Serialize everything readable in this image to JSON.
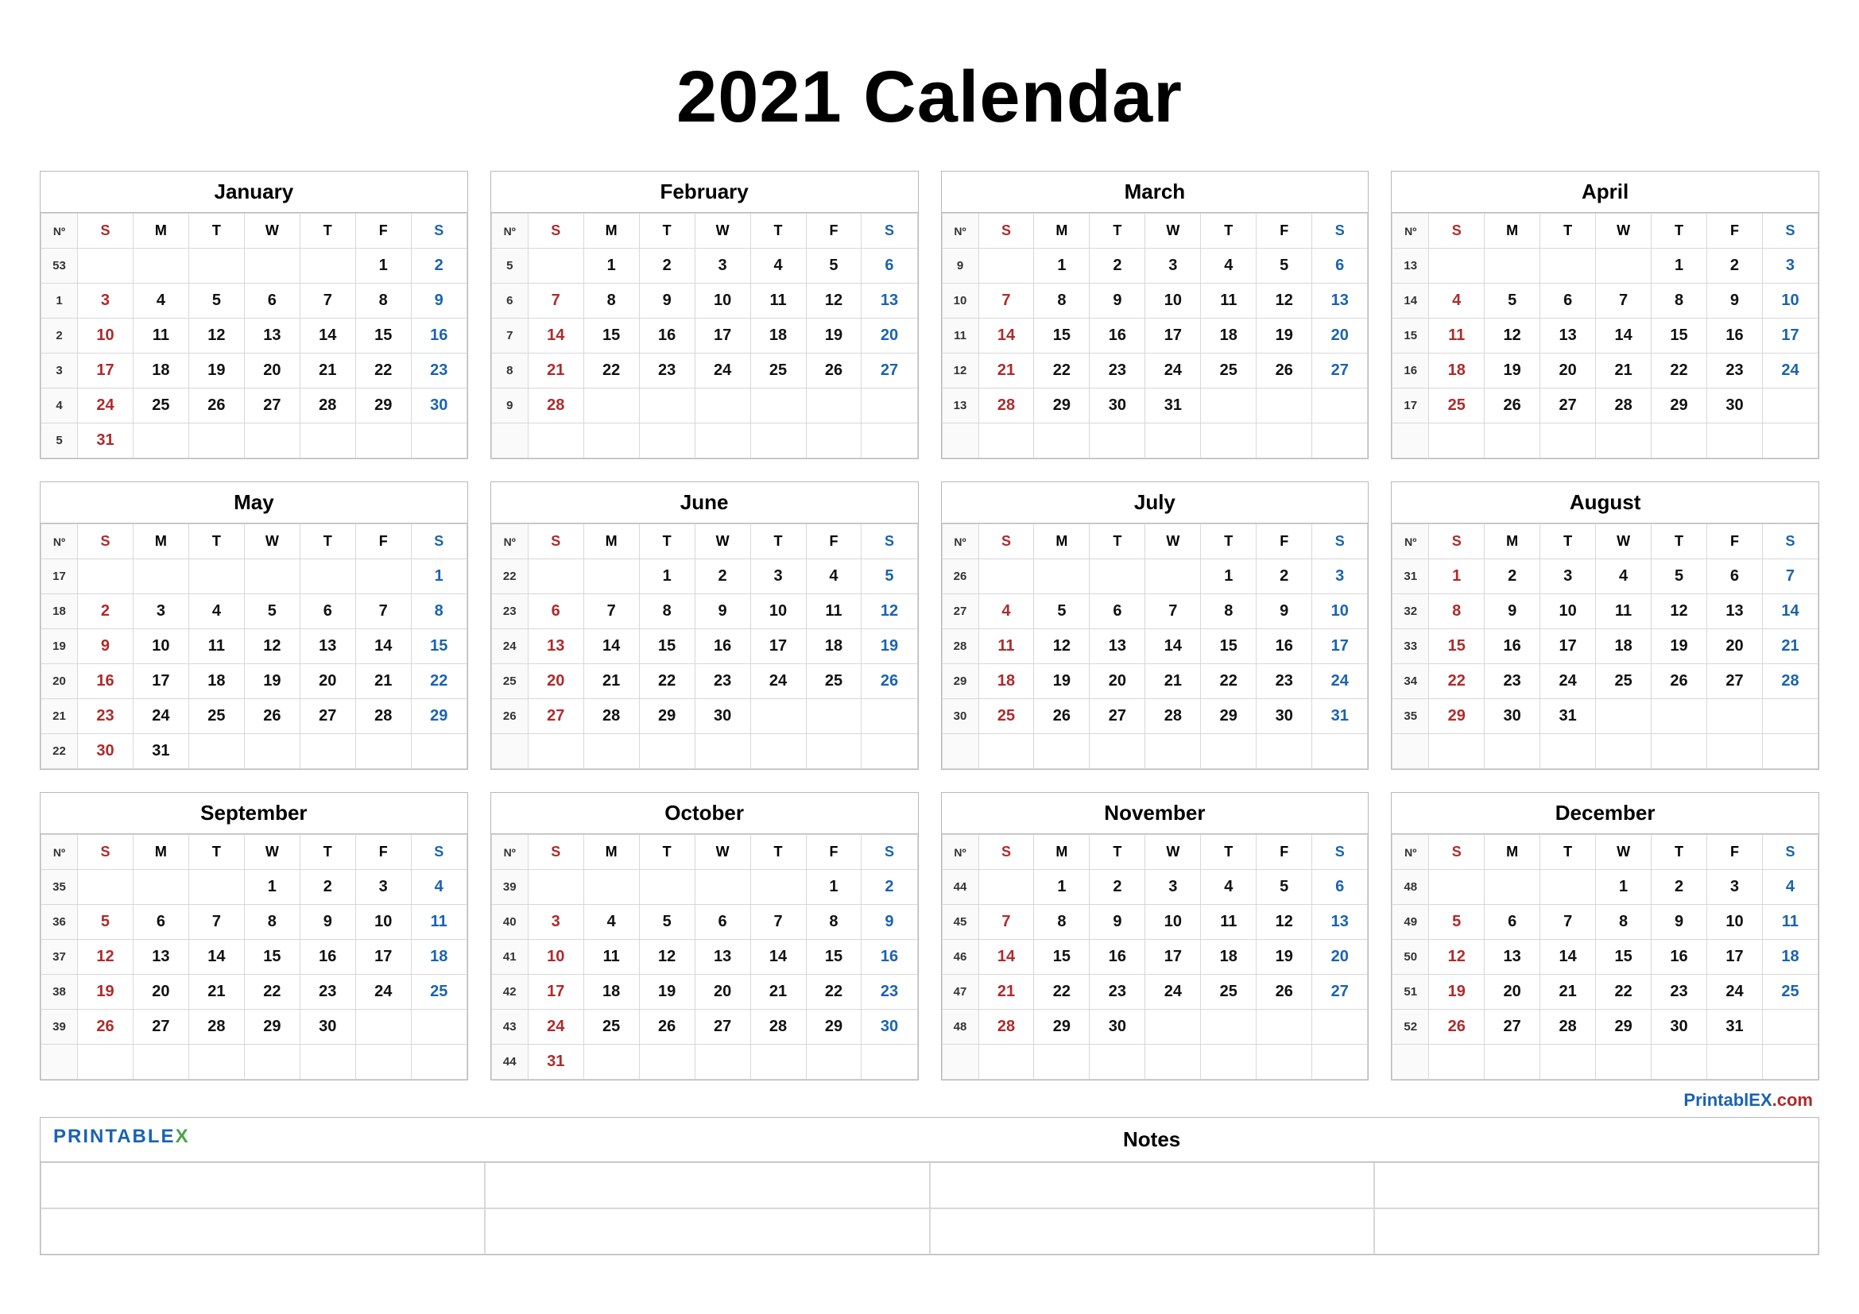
{
  "title": "2021 Calendar",
  "week_header": {
    "nk": "Nº",
    "days": [
      "S",
      "M",
      "T",
      "W",
      "T",
      "F",
      "S"
    ]
  },
  "footer": {
    "brand": "PrintablEX",
    "domain": ".com",
    "notes_label": "Notes",
    "logo_text": "PRINTABLE",
    "logo_x": "X"
  },
  "months": [
    {
      "name": "January",
      "weeks": [
        {
          "n": "53",
          "d": [
            "",
            "",
            "",
            "",
            "",
            "1",
            "2"
          ]
        },
        {
          "n": "1",
          "d": [
            "3",
            "4",
            "5",
            "6",
            "7",
            "8",
            "9"
          ]
        },
        {
          "n": "2",
          "d": [
            "10",
            "11",
            "12",
            "13",
            "14",
            "15",
            "16"
          ]
        },
        {
          "n": "3",
          "d": [
            "17",
            "18",
            "19",
            "20",
            "21",
            "22",
            "23"
          ]
        },
        {
          "n": "4",
          "d": [
            "24",
            "25",
            "26",
            "27",
            "28",
            "29",
            "30"
          ]
        },
        {
          "n": "5",
          "d": [
            "31",
            "",
            "",
            "",
            "",
            "",
            ""
          ]
        }
      ]
    },
    {
      "name": "February",
      "weeks": [
        {
          "n": "5",
          "d": [
            "",
            "1",
            "2",
            "3",
            "4",
            "5",
            "6"
          ]
        },
        {
          "n": "6",
          "d": [
            "7",
            "8",
            "9",
            "10",
            "11",
            "12",
            "13"
          ]
        },
        {
          "n": "7",
          "d": [
            "14",
            "15",
            "16",
            "17",
            "18",
            "19",
            "20"
          ]
        },
        {
          "n": "8",
          "d": [
            "21",
            "22",
            "23",
            "24",
            "25",
            "26",
            "27"
          ]
        },
        {
          "n": "9",
          "d": [
            "28",
            "",
            "",
            "",
            "",
            "",
            ""
          ]
        },
        {
          "n": "",
          "d": [
            "",
            "",
            "",
            "",
            "",
            "",
            ""
          ]
        }
      ]
    },
    {
      "name": "March",
      "weeks": [
        {
          "n": "9",
          "d": [
            "",
            "1",
            "2",
            "3",
            "4",
            "5",
            "6"
          ]
        },
        {
          "n": "10",
          "d": [
            "7",
            "8",
            "9",
            "10",
            "11",
            "12",
            "13"
          ]
        },
        {
          "n": "11",
          "d": [
            "14",
            "15",
            "16",
            "17",
            "18",
            "19",
            "20"
          ]
        },
        {
          "n": "12",
          "d": [
            "21",
            "22",
            "23",
            "24",
            "25",
            "26",
            "27"
          ]
        },
        {
          "n": "13",
          "d": [
            "28",
            "29",
            "30",
            "31",
            "",
            "",
            ""
          ]
        },
        {
          "n": "",
          "d": [
            "",
            "",
            "",
            "",
            "",
            "",
            ""
          ]
        }
      ]
    },
    {
      "name": "April",
      "weeks": [
        {
          "n": "13",
          "d": [
            "",
            "",
            "",
            "",
            "1",
            "2",
            "3"
          ]
        },
        {
          "n": "14",
          "d": [
            "4",
            "5",
            "6",
            "7",
            "8",
            "9",
            "10"
          ]
        },
        {
          "n": "15",
          "d": [
            "11",
            "12",
            "13",
            "14",
            "15",
            "16",
            "17"
          ]
        },
        {
          "n": "16",
          "d": [
            "18",
            "19",
            "20",
            "21",
            "22",
            "23",
            "24"
          ]
        },
        {
          "n": "17",
          "d": [
            "25",
            "26",
            "27",
            "28",
            "29",
            "30",
            ""
          ]
        },
        {
          "n": "",
          "d": [
            "",
            "",
            "",
            "",
            "",
            "",
            ""
          ]
        }
      ]
    },
    {
      "name": "May",
      "weeks": [
        {
          "n": "17",
          "d": [
            "",
            "",
            "",
            "",
            "",
            "",
            "1"
          ]
        },
        {
          "n": "18",
          "d": [
            "2",
            "3",
            "4",
            "5",
            "6",
            "7",
            "8"
          ]
        },
        {
          "n": "19",
          "d": [
            "9",
            "10",
            "11",
            "12",
            "13",
            "14",
            "15"
          ]
        },
        {
          "n": "20",
          "d": [
            "16",
            "17",
            "18",
            "19",
            "20",
            "21",
            "22"
          ]
        },
        {
          "n": "21",
          "d": [
            "23",
            "24",
            "25",
            "26",
            "27",
            "28",
            "29"
          ]
        },
        {
          "n": "22",
          "d": [
            "30",
            "31",
            "",
            "",
            "",
            "",
            ""
          ]
        }
      ]
    },
    {
      "name": "June",
      "weeks": [
        {
          "n": "22",
          "d": [
            "",
            "",
            "1",
            "2",
            "3",
            "4",
            "5"
          ]
        },
        {
          "n": "23",
          "d": [
            "6",
            "7",
            "8",
            "9",
            "10",
            "11",
            "12"
          ]
        },
        {
          "n": "24",
          "d": [
            "13",
            "14",
            "15",
            "16",
            "17",
            "18",
            "19"
          ]
        },
        {
          "n": "25",
          "d": [
            "20",
            "21",
            "22",
            "23",
            "24",
            "25",
            "26"
          ]
        },
        {
          "n": "26",
          "d": [
            "27",
            "28",
            "29",
            "30",
            "",
            "",
            ""
          ]
        },
        {
          "n": "",
          "d": [
            "",
            "",
            "",
            "",
            "",
            "",
            ""
          ]
        }
      ]
    },
    {
      "name": "July",
      "weeks": [
        {
          "n": "26",
          "d": [
            "",
            "",
            "",
            "",
            "1",
            "2",
            "3"
          ]
        },
        {
          "n": "27",
          "d": [
            "4",
            "5",
            "6",
            "7",
            "8",
            "9",
            "10"
          ]
        },
        {
          "n": "28",
          "d": [
            "11",
            "12",
            "13",
            "14",
            "15",
            "16",
            "17"
          ]
        },
        {
          "n": "29",
          "d": [
            "18",
            "19",
            "20",
            "21",
            "22",
            "23",
            "24"
          ]
        },
        {
          "n": "30",
          "d": [
            "25",
            "26",
            "27",
            "28",
            "29",
            "30",
            "31"
          ]
        },
        {
          "n": "",
          "d": [
            "",
            "",
            "",
            "",
            "",
            "",
            ""
          ]
        }
      ]
    },
    {
      "name": "August",
      "weeks": [
        {
          "n": "31",
          "d": [
            "1",
            "2",
            "3",
            "4",
            "5",
            "6",
            "7"
          ]
        },
        {
          "n": "32",
          "d": [
            "8",
            "9",
            "10",
            "11",
            "12",
            "13",
            "14"
          ]
        },
        {
          "n": "33",
          "d": [
            "15",
            "16",
            "17",
            "18",
            "19",
            "20",
            "21"
          ]
        },
        {
          "n": "34",
          "d": [
            "22",
            "23",
            "24",
            "25",
            "26",
            "27",
            "28"
          ]
        },
        {
          "n": "35",
          "d": [
            "29",
            "30",
            "31",
            "",
            "",
            "",
            ""
          ]
        },
        {
          "n": "",
          "d": [
            "",
            "",
            "",
            "",
            "",
            "",
            ""
          ]
        }
      ]
    },
    {
      "name": "September",
      "weeks": [
        {
          "n": "35",
          "d": [
            "",
            "",
            "",
            "1",
            "2",
            "3",
            "4"
          ]
        },
        {
          "n": "36",
          "d": [
            "5",
            "6",
            "7",
            "8",
            "9",
            "10",
            "11"
          ]
        },
        {
          "n": "37",
          "d": [
            "12",
            "13",
            "14",
            "15",
            "16",
            "17",
            "18"
          ]
        },
        {
          "n": "38",
          "d": [
            "19",
            "20",
            "21",
            "22",
            "23",
            "24",
            "25"
          ]
        },
        {
          "n": "39",
          "d": [
            "26",
            "27",
            "28",
            "29",
            "30",
            "",
            ""
          ]
        },
        {
          "n": "",
          "d": [
            "",
            "",
            "",
            "",
            "",
            "",
            ""
          ]
        }
      ]
    },
    {
      "name": "October",
      "weeks": [
        {
          "n": "39",
          "d": [
            "",
            "",
            "",
            "",
            "",
            "1",
            "2"
          ]
        },
        {
          "n": "40",
          "d": [
            "3",
            "4",
            "5",
            "6",
            "7",
            "8",
            "9"
          ]
        },
        {
          "n": "41",
          "d": [
            "10",
            "11",
            "12",
            "13",
            "14",
            "15",
            "16"
          ]
        },
        {
          "n": "42",
          "d": [
            "17",
            "18",
            "19",
            "20",
            "21",
            "22",
            "23"
          ]
        },
        {
          "n": "43",
          "d": [
            "24",
            "25",
            "26",
            "27",
            "28",
            "29",
            "30"
          ]
        },
        {
          "n": "44",
          "d": [
            "31",
            "",
            "",
            "",
            "",
            "",
            ""
          ]
        }
      ]
    },
    {
      "name": "November",
      "weeks": [
        {
          "n": "44",
          "d": [
            "",
            "1",
            "2",
            "3",
            "4",
            "5",
            "6"
          ]
        },
        {
          "n": "45",
          "d": [
            "7",
            "8",
            "9",
            "10",
            "11",
            "12",
            "13"
          ]
        },
        {
          "n": "46",
          "d": [
            "14",
            "15",
            "16",
            "17",
            "18",
            "19",
            "20"
          ]
        },
        {
          "n": "47",
          "d": [
            "21",
            "22",
            "23",
            "24",
            "25",
            "26",
            "27"
          ]
        },
        {
          "n": "48",
          "d": [
            "28",
            "29",
            "30",
            "",
            "",
            "",
            ""
          ]
        },
        {
          "n": "",
          "d": [
            "",
            "",
            "",
            "",
            "",
            "",
            ""
          ]
        }
      ]
    },
    {
      "name": "December",
      "weeks": [
        {
          "n": "48",
          "d": [
            "",
            "",
            "",
            "1",
            "2",
            "3",
            "4"
          ]
        },
        {
          "n": "49",
          "d": [
            "5",
            "6",
            "7",
            "8",
            "9",
            "10",
            "11"
          ]
        },
        {
          "n": "50",
          "d": [
            "12",
            "13",
            "14",
            "15",
            "16",
            "17",
            "18"
          ]
        },
        {
          "n": "51",
          "d": [
            "19",
            "20",
            "21",
            "22",
            "23",
            "24",
            "25"
          ]
        },
        {
          "n": "52",
          "d": [
            "26",
            "27",
            "28",
            "29",
            "30",
            "31",
            ""
          ]
        },
        {
          "n": "",
          "d": [
            "",
            "",
            "",
            "",
            "",
            "",
            ""
          ]
        }
      ]
    }
  ]
}
